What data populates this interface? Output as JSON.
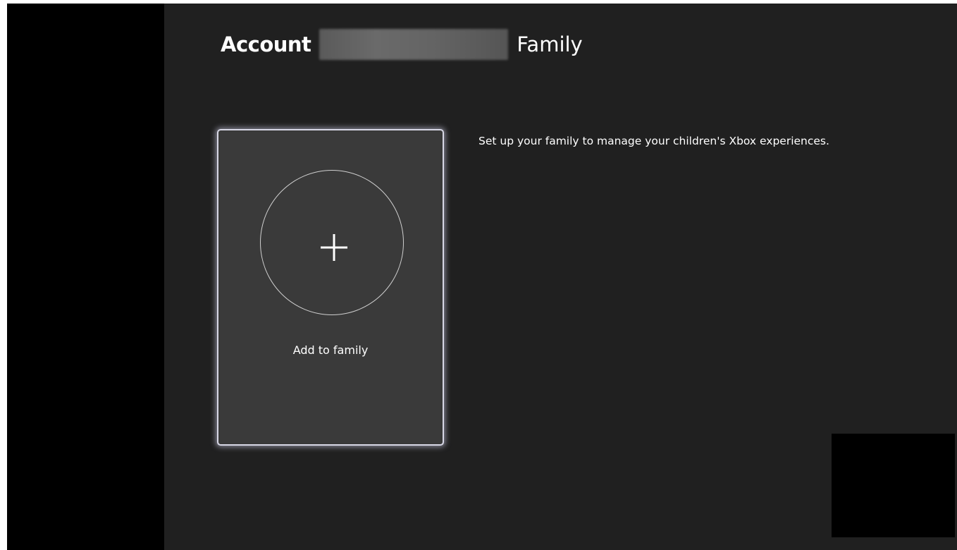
{
  "header": {
    "account_label": "Account",
    "family_label": "Family"
  },
  "add_card": {
    "label": "Add to family",
    "icon": "plus-icon"
  },
  "description": "Set up your family to manage your children's Xbox experiences.",
  "colors": {
    "main_background": "#202020",
    "card_background": "#3a3a3a",
    "card_focus_border": "#d8d8e6",
    "text": "#ffffff"
  }
}
